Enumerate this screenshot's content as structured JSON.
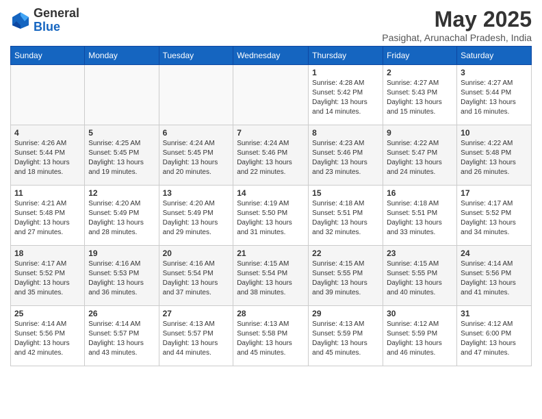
{
  "header": {
    "logo_general": "General",
    "logo_blue": "Blue",
    "month": "May 2025",
    "location": "Pasighat, Arunachal Pradesh, India"
  },
  "days_of_week": [
    "Sunday",
    "Monday",
    "Tuesday",
    "Wednesday",
    "Thursday",
    "Friday",
    "Saturday"
  ],
  "weeks": [
    [
      {
        "day": "",
        "info": ""
      },
      {
        "day": "",
        "info": ""
      },
      {
        "day": "",
        "info": ""
      },
      {
        "day": "",
        "info": ""
      },
      {
        "day": "1",
        "info": "Sunrise: 4:28 AM\nSunset: 5:42 PM\nDaylight: 13 hours\nand 14 minutes."
      },
      {
        "day": "2",
        "info": "Sunrise: 4:27 AM\nSunset: 5:43 PM\nDaylight: 13 hours\nand 15 minutes."
      },
      {
        "day": "3",
        "info": "Sunrise: 4:27 AM\nSunset: 5:44 PM\nDaylight: 13 hours\nand 16 minutes."
      }
    ],
    [
      {
        "day": "4",
        "info": "Sunrise: 4:26 AM\nSunset: 5:44 PM\nDaylight: 13 hours\nand 18 minutes."
      },
      {
        "day": "5",
        "info": "Sunrise: 4:25 AM\nSunset: 5:45 PM\nDaylight: 13 hours\nand 19 minutes."
      },
      {
        "day": "6",
        "info": "Sunrise: 4:24 AM\nSunset: 5:45 PM\nDaylight: 13 hours\nand 20 minutes."
      },
      {
        "day": "7",
        "info": "Sunrise: 4:24 AM\nSunset: 5:46 PM\nDaylight: 13 hours\nand 22 minutes."
      },
      {
        "day": "8",
        "info": "Sunrise: 4:23 AM\nSunset: 5:46 PM\nDaylight: 13 hours\nand 23 minutes."
      },
      {
        "day": "9",
        "info": "Sunrise: 4:22 AM\nSunset: 5:47 PM\nDaylight: 13 hours\nand 24 minutes."
      },
      {
        "day": "10",
        "info": "Sunrise: 4:22 AM\nSunset: 5:48 PM\nDaylight: 13 hours\nand 26 minutes."
      }
    ],
    [
      {
        "day": "11",
        "info": "Sunrise: 4:21 AM\nSunset: 5:48 PM\nDaylight: 13 hours\nand 27 minutes."
      },
      {
        "day": "12",
        "info": "Sunrise: 4:20 AM\nSunset: 5:49 PM\nDaylight: 13 hours\nand 28 minutes."
      },
      {
        "day": "13",
        "info": "Sunrise: 4:20 AM\nSunset: 5:49 PM\nDaylight: 13 hours\nand 29 minutes."
      },
      {
        "day": "14",
        "info": "Sunrise: 4:19 AM\nSunset: 5:50 PM\nDaylight: 13 hours\nand 31 minutes."
      },
      {
        "day": "15",
        "info": "Sunrise: 4:18 AM\nSunset: 5:51 PM\nDaylight: 13 hours\nand 32 minutes."
      },
      {
        "day": "16",
        "info": "Sunrise: 4:18 AM\nSunset: 5:51 PM\nDaylight: 13 hours\nand 33 minutes."
      },
      {
        "day": "17",
        "info": "Sunrise: 4:17 AM\nSunset: 5:52 PM\nDaylight: 13 hours\nand 34 minutes."
      }
    ],
    [
      {
        "day": "18",
        "info": "Sunrise: 4:17 AM\nSunset: 5:52 PM\nDaylight: 13 hours\nand 35 minutes."
      },
      {
        "day": "19",
        "info": "Sunrise: 4:16 AM\nSunset: 5:53 PM\nDaylight: 13 hours\nand 36 minutes."
      },
      {
        "day": "20",
        "info": "Sunrise: 4:16 AM\nSunset: 5:54 PM\nDaylight: 13 hours\nand 37 minutes."
      },
      {
        "day": "21",
        "info": "Sunrise: 4:15 AM\nSunset: 5:54 PM\nDaylight: 13 hours\nand 38 minutes."
      },
      {
        "day": "22",
        "info": "Sunrise: 4:15 AM\nSunset: 5:55 PM\nDaylight: 13 hours\nand 39 minutes."
      },
      {
        "day": "23",
        "info": "Sunrise: 4:15 AM\nSunset: 5:55 PM\nDaylight: 13 hours\nand 40 minutes."
      },
      {
        "day": "24",
        "info": "Sunrise: 4:14 AM\nSunset: 5:56 PM\nDaylight: 13 hours\nand 41 minutes."
      }
    ],
    [
      {
        "day": "25",
        "info": "Sunrise: 4:14 AM\nSunset: 5:56 PM\nDaylight: 13 hours\nand 42 minutes."
      },
      {
        "day": "26",
        "info": "Sunrise: 4:14 AM\nSunset: 5:57 PM\nDaylight: 13 hours\nand 43 minutes."
      },
      {
        "day": "27",
        "info": "Sunrise: 4:13 AM\nSunset: 5:57 PM\nDaylight: 13 hours\nand 44 minutes."
      },
      {
        "day": "28",
        "info": "Sunrise: 4:13 AM\nSunset: 5:58 PM\nDaylight: 13 hours\nand 45 minutes."
      },
      {
        "day": "29",
        "info": "Sunrise: 4:13 AM\nSunset: 5:59 PM\nDaylight: 13 hours\nand 45 minutes."
      },
      {
        "day": "30",
        "info": "Sunrise: 4:12 AM\nSunset: 5:59 PM\nDaylight: 13 hours\nand 46 minutes."
      },
      {
        "day": "31",
        "info": "Sunrise: 4:12 AM\nSunset: 6:00 PM\nDaylight: 13 hours\nand 47 minutes."
      }
    ]
  ]
}
